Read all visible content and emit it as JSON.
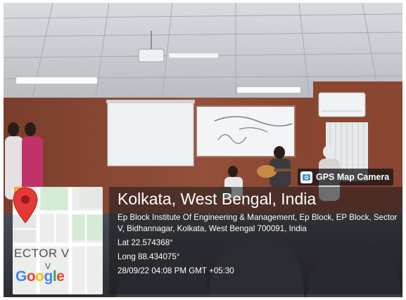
{
  "badge": {
    "label": "GPS Map Camera",
    "icon": "gps-map-camera-icon"
  },
  "location": {
    "title": "Kolkata, West Bengal, India",
    "address": "Ep Block Institute Of Engineering & Management, Ep Block, EP Block, Sector V, Bidhannagar, Kolkata, West Bengal 700091, India",
    "lat": "Lat 22.574368°",
    "long": "Long 88.434075°",
    "timestamp": "28/09/22 04:08 PM GMT +05:30"
  },
  "map": {
    "area_label": "ECTOR V",
    "sub_label": "V",
    "logo_letters": [
      {
        "ch": "G",
        "color": "#4285F4"
      },
      {
        "ch": "o",
        "color": "#EA4335"
      },
      {
        "ch": "o",
        "color": "#FBBC05"
      },
      {
        "ch": "g",
        "color": "#4285F4"
      },
      {
        "ch": "l",
        "color": "#34A853"
      },
      {
        "ch": "e",
        "color": "#EA4335"
      }
    ],
    "pin_color": "#E53935",
    "poi_color": "#F2A33A"
  }
}
